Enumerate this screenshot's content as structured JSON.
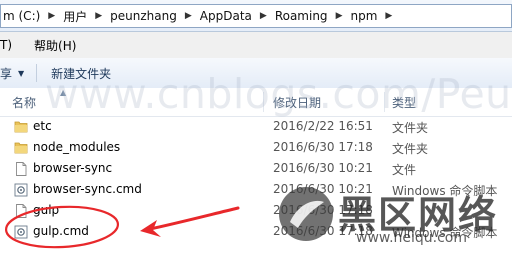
{
  "address_bar": {
    "crumbs": [
      "m (C:)",
      "用户",
      "peunzhang",
      "AppData",
      "Roaming",
      "npm"
    ],
    "arrow": "▶"
  },
  "menu": {
    "items": [
      "T)",
      "帮助(H)"
    ]
  },
  "toolbar": {
    "share_label": "享",
    "share_arrow": "▼",
    "new_folder_label": "新建文件夹"
  },
  "columns": {
    "name": "名称",
    "modified": "修改日期",
    "type": "类型"
  },
  "files": [
    {
      "name": "etc",
      "modified": "2016/2/22 16:51",
      "type": "文件夹",
      "icon": "folder-icon"
    },
    {
      "name": "node_modules",
      "modified": "2016/6/30 17:18",
      "type": "文件夹",
      "icon": "folder-icon"
    },
    {
      "name": "browser-sync",
      "modified": "2016/6/30 10:21",
      "type": "文件",
      "icon": "file-icon"
    },
    {
      "name": "browser-sync.cmd",
      "modified": "2016/6/30 10:21",
      "type": "Windows 命令脚本",
      "icon": "cmd-file-icon"
    },
    {
      "name": "gulp",
      "modified": "2016/6/30 17:18",
      "type": "",
      "icon": "file-icon"
    },
    {
      "name": "gulp.cmd",
      "modified": "2016/6/30 17:18",
      "type": "Windows 命令脚本",
      "icon": "cmd-file-icon"
    }
  ],
  "watermarks": {
    "url": "www.cnblogs.com/PeunZhang/",
    "logo_text": "黑区网络",
    "logo_sub": "www.heiqu.com"
  },
  "colors": {
    "annotation": "#e8282b",
    "folder": "#e9c25a",
    "header_text": "#4c607a"
  }
}
